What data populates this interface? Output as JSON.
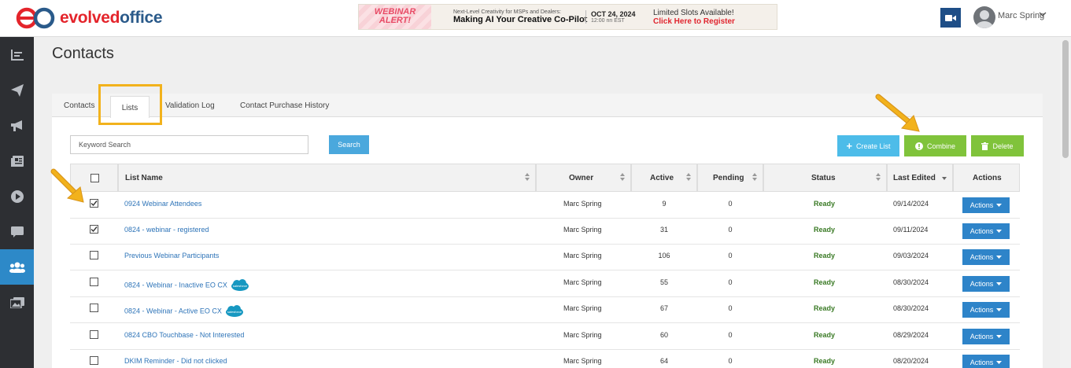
{
  "brand": {
    "part1": "evolved",
    "part2": "office"
  },
  "banner": {
    "alert_line1": "WEBINAR",
    "alert_line2": "ALERT!",
    "subtitle": "Next-Level Creativity for MSPs and Dealers:",
    "title": "Making AI Your Creative Co-Pilot",
    "date": "OCT 24, 2024",
    "time": "12:00 nn EST",
    "cta_line1": "Limited Slots Available!",
    "cta_line2": "Click Here to Register"
  },
  "user": {
    "name": "Marc Spring"
  },
  "page_title": "Contacts",
  "tabs": [
    {
      "label": "Contacts"
    },
    {
      "label": "Lists"
    },
    {
      "label": "Validation Log"
    },
    {
      "label": "Contact Purchase History"
    }
  ],
  "search": {
    "placeholder": "Keyword Search",
    "button": "Search"
  },
  "buttons": {
    "create": "Create List",
    "combine": "Combine",
    "delete": "Delete"
  },
  "table": {
    "headers": [
      "List Name",
      "Owner",
      "Active",
      "Pending",
      "Status",
      "Last Edited",
      "Actions"
    ],
    "rows": [
      {
        "checked": true,
        "name": "0924 Webinar Attendees",
        "salesforce": false,
        "owner": "Marc Spring",
        "active": "9",
        "pending": "0",
        "status": "Ready",
        "edited": "09/14/2024",
        "action": "Actions"
      },
      {
        "checked": true,
        "name": "0824 - webinar - registered",
        "salesforce": false,
        "owner": "Marc Spring",
        "active": "31",
        "pending": "0",
        "status": "Ready",
        "edited": "09/11/2024",
        "action": "Actions"
      },
      {
        "checked": false,
        "name": "Previous Webinar Participants",
        "salesforce": false,
        "owner": "Marc Spring",
        "active": "106",
        "pending": "0",
        "status": "Ready",
        "edited": "09/03/2024",
        "action": "Actions"
      },
      {
        "checked": false,
        "name": "0824 - Webinar - Inactive EO CX",
        "salesforce": true,
        "owner": "Marc Spring",
        "active": "55",
        "pending": "0",
        "status": "Ready",
        "edited": "08/30/2024",
        "action": "Actions"
      },
      {
        "checked": false,
        "name": "0824 - Webinar - Active EO CX",
        "salesforce": true,
        "owner": "Marc Spring",
        "active": "67",
        "pending": "0",
        "status": "Ready",
        "edited": "08/30/2024",
        "action": "Actions"
      },
      {
        "checked": false,
        "name": "0824 CBO Touchbase - Not Interested",
        "salesforce": false,
        "owner": "Marc Spring",
        "active": "60",
        "pending": "0",
        "status": "Ready",
        "edited": "08/29/2024",
        "action": "Actions"
      },
      {
        "checked": false,
        "name": "DKIM Reminder - Did not clicked",
        "salesforce": false,
        "owner": "Marc Spring",
        "active": "64",
        "pending": "0",
        "status": "Ready",
        "edited": "08/20/2024",
        "action": "Actions"
      }
    ]
  },
  "sidebar_icons": [
    "dashboard-icon",
    "send-icon",
    "megaphone-icon",
    "newspaper-icon",
    "play-icon",
    "chat-icon",
    "users-icon",
    "gallery-icon"
  ],
  "colors": {
    "accent": "#2d89c8",
    "green": "#80c33b",
    "annotation": "#f2b21c"
  }
}
